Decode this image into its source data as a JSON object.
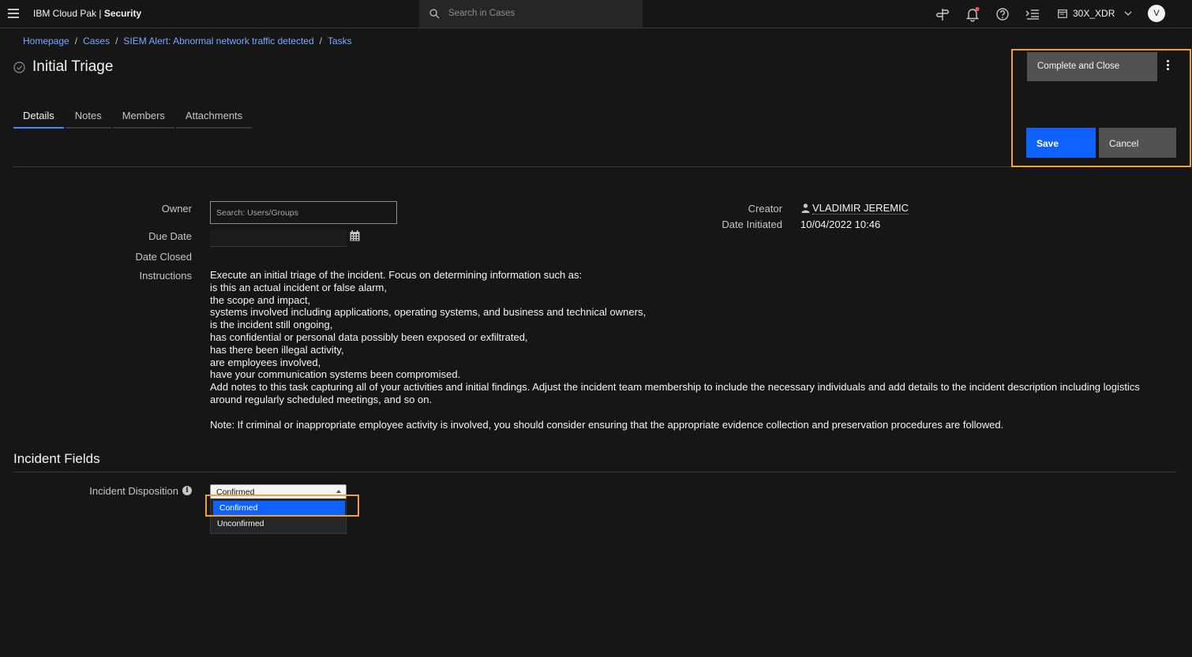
{
  "header": {
    "app_name_prefix": "IBM Cloud Pak | ",
    "app_name_bold": "Security",
    "search_placeholder": "Search in Cases",
    "tenant": "30X_XDR",
    "avatar_initial": "V"
  },
  "breadcrumb": [
    "Homepage",
    "Cases",
    "SIEM Alert: Abnormal network traffic detected",
    "Tasks"
  ],
  "page": {
    "title": "Initial Triage"
  },
  "tabs": [
    "Details",
    "Notes",
    "Members",
    "Attachments"
  ],
  "actions": {
    "complete_label": "Complete and Close",
    "save_label": "Save",
    "cancel_label": "Cancel"
  },
  "details": {
    "owner_label": "Owner",
    "owner_placeholder": "Search: Users/Groups",
    "due_date_label": "Due Date",
    "due_date_value": "",
    "date_closed_label": "Date Closed",
    "instructions_label": "Instructions",
    "creator_label": "Creator",
    "creator_value": "VLADIMIR JEREMIC",
    "date_initiated_label": "Date Initiated",
    "date_initiated_value": "10/04/2022 10:46",
    "instructions": [
      "Execute an initial triage of the incident. Focus on determining information such as:",
      "is this an actual incident or false alarm,",
      "the scope and impact,",
      "systems involved including applications, operating systems, and business and technical owners,",
      "is the incident still ongoing,",
      "has confidential or personal data possibly been exposed or exfiltrated,",
      "has there been illegal activity,",
      "are employees involved,",
      "have your communication systems been compromised.",
      "Add notes to this task capturing all of your activities and initial findings. Adjust the incident team membership to include the necessary individuals and add details to the incident description including logistics around regularly scheduled meetings, and so on.",
      "",
      "Note: If criminal or inappropriate employee activity is involved, you should consider ensuring that the appropriate evidence collection and preservation procedures are followed."
    ]
  },
  "incident_fields": {
    "section_title": "Incident Fields",
    "disposition_label": "Incident Disposition",
    "disposition_value": "Confirmed",
    "options": [
      "Confirmed",
      "Unconfirmed"
    ]
  },
  "colors": {
    "accent": "#0f62fe",
    "link": "#78a9ff",
    "highlight_frame": "#f1a035",
    "background": "#161616"
  }
}
